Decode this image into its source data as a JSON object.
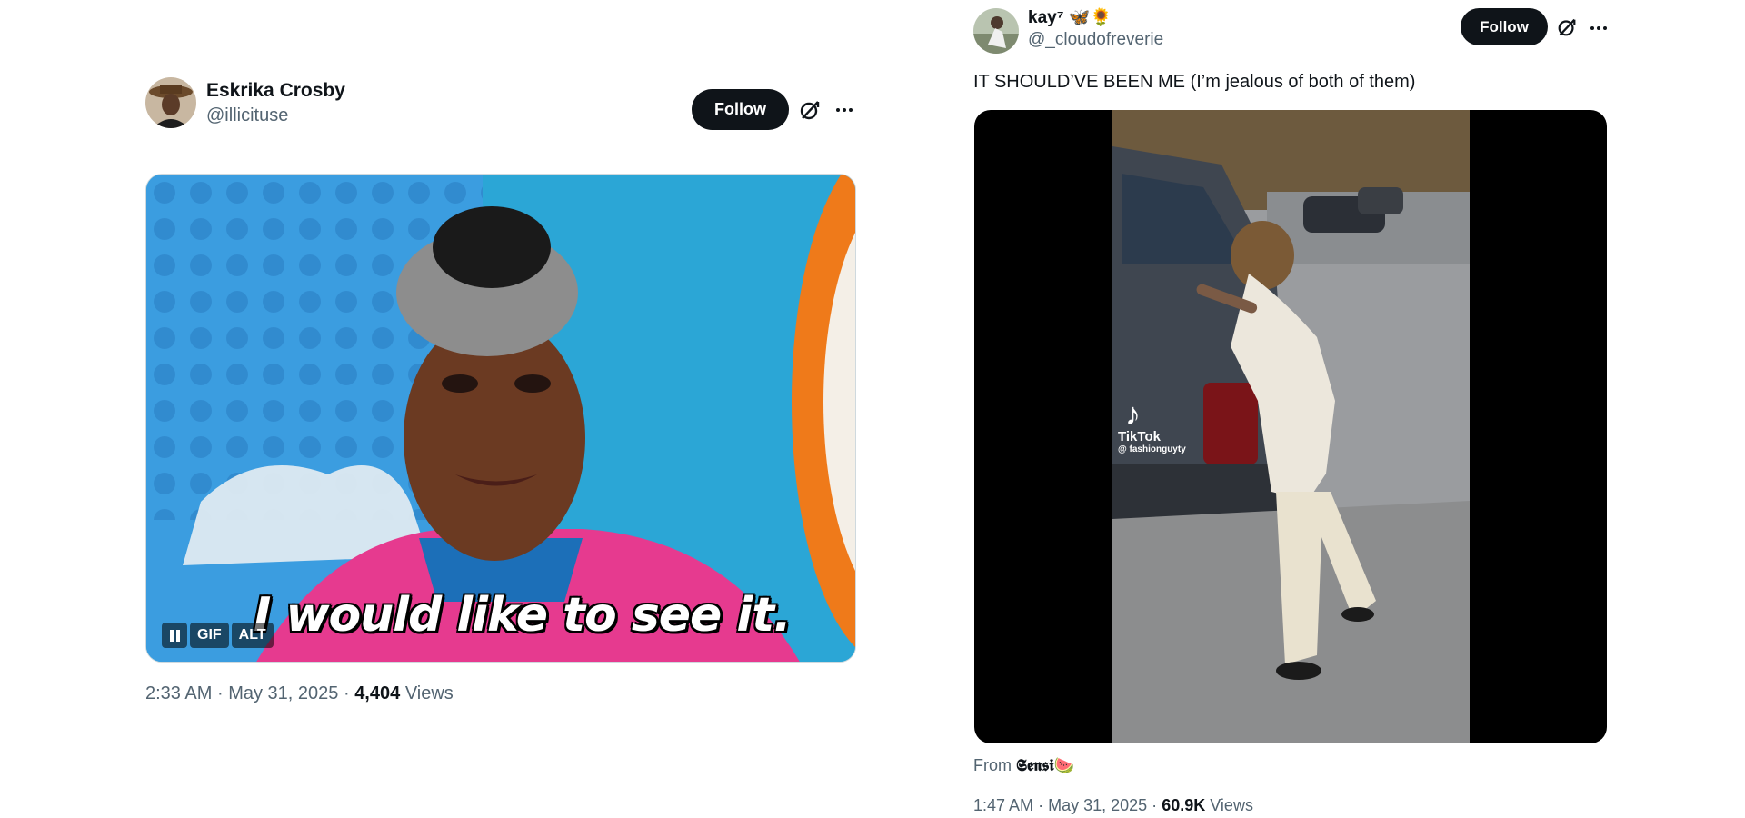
{
  "tweets": [
    {
      "author": {
        "display_name": "Eskrika Crosby",
        "handle": "@illicituse",
        "avatar_icon": "avatar-photo"
      },
      "follow_label": "Follow",
      "media": {
        "type": "gif",
        "caption": "I would like to see it.",
        "controls": {
          "pause_icon": "pause-icon",
          "gif_label": "GIF",
          "alt_label": "ALT"
        }
      },
      "meta": {
        "time": "2:33 AM",
        "separator": "·",
        "date": "May 31, 2025",
        "views_count": "4,404",
        "views_label": "Views"
      }
    },
    {
      "author": {
        "display_name": "kay⁷ 🦋🌻",
        "handle": "@_cloudofreverie",
        "avatar_icon": "avatar-photo"
      },
      "follow_label": "Follow",
      "text": "IT SHOULD’VE BEEN ME (I’m jealous of both of them)",
      "media": {
        "type": "video",
        "watermark": {
          "logo_icon": "tiktok-icon",
          "name": "TikTok",
          "user": "@ fashionguyty"
        }
      },
      "from": {
        "prefix": "From",
        "source": "𝕾𝖊𝖓𝖘𝖎🍉"
      },
      "meta": {
        "time": "1:47 AM",
        "separator": "·",
        "date": "May 31, 2025",
        "views_count": "60.9K",
        "views_label": "Views"
      }
    }
  ],
  "colors": {
    "text_primary": "#0f1419",
    "text_secondary": "#536471",
    "follow_bg": "#0f1419",
    "follow_text": "#ffffff"
  }
}
